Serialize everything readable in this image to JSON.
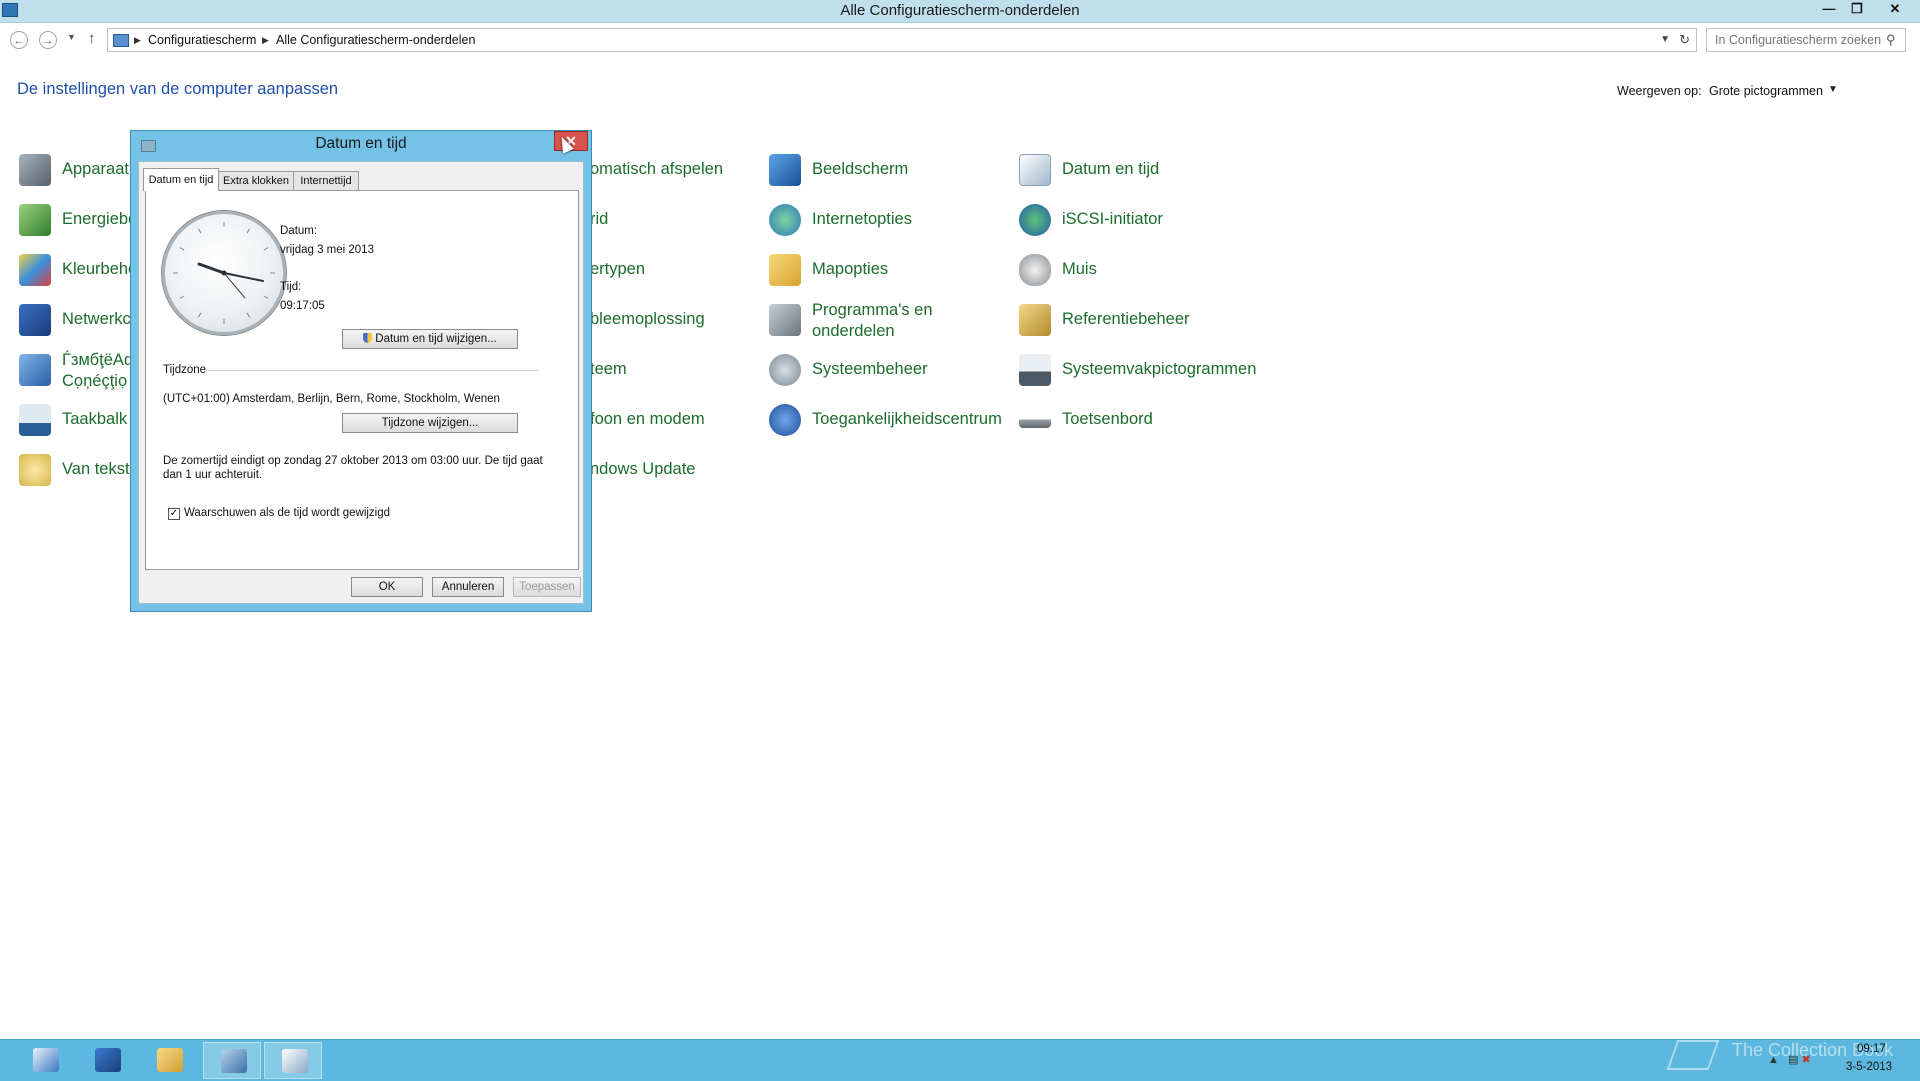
{
  "window": {
    "title": "Alle Configuratiescherm-onderdelen"
  },
  "address": {
    "crumbs": [
      "Configuratiescherm",
      "Alle Configuratiescherm-onderdelen"
    ],
    "search_placeholder": "In Configuratiescherm zoeken"
  },
  "header": {
    "heading": "De instellingen van de computer aanpassen",
    "viewby_label": "Weergeven op:",
    "viewby_value": "Grote pictogrammen"
  },
  "items": {
    "col1": [
      "Apparaatb",
      "Energiebe",
      "Kleurbehe",
      "Netwerkc",
      "ЃзмбţёАф",
      "Taakbalk",
      "Van tekst"
    ],
    "col1_r5_line2": "Cо̣ņéçţiọ",
    "col2": [
      "omatisch afspelen",
      "rid",
      "ertypen",
      "bleemoplossing",
      "teem",
      "foon en modem",
      "ndows Update"
    ],
    "col3": [
      "Beeldscherm",
      "Internetopties",
      "Mapopties",
      "Programma's en onderdelen",
      "Systeembeheer",
      "Toegankelijkheidscentrum"
    ],
    "col4": [
      "Datum en tijd",
      "iSCSI-initiator",
      "Muis",
      "Referentiebeheer",
      "Systeemvakpictogrammen",
      "Toetsenbord"
    ]
  },
  "dialog": {
    "title": "Datum en tijd",
    "tabs": [
      "Datum en tijd",
      "Extra klokken",
      "Internettijd"
    ],
    "date_label": "Datum:",
    "date_value": "vrijdag 3 mei 2013",
    "time_label": "Tijd:",
    "time_value": "09:17:05",
    "change_datetime": "Datum en tijd wijzigen...",
    "timezone_title": "Tijdzone",
    "timezone_value": "(UTC+01:00) Amsterdam, Berlijn, Bern, Rome, Stockholm, Wenen",
    "change_timezone": "Tijdzone wijzigen...",
    "dst_note": "De zomertijd eindigt op zondag 27 oktober 2013 om 03:00 uur. De tijd gaat dan 1 uur achteruit.",
    "warn_checkbox": "Waarschuwen als de tijd wordt gewijzigd",
    "ok": "OK",
    "cancel": "Annuleren",
    "apply": "Toepassen"
  },
  "taskbar": {
    "time": "09:17",
    "date": "3-5-2013",
    "watermark": "The Collection Book"
  },
  "colors": {
    "link_green": "#1c6c2c",
    "heading_blue": "#1f4fa8",
    "taskbar": "#5cb8de",
    "dialog_frame": "#74c3e7"
  }
}
